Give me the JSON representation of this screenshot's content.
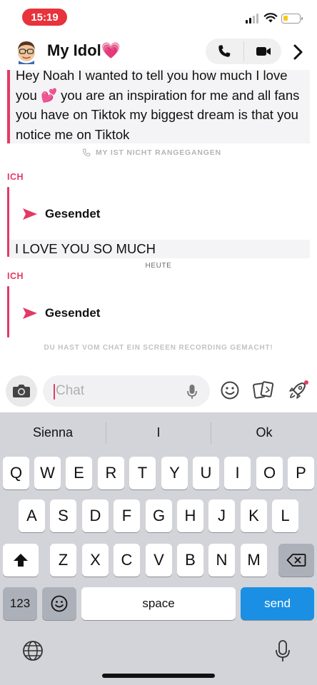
{
  "status_bar": {
    "time": "15:19",
    "battery_color": "#f7c821"
  },
  "header": {
    "contact_name": "My Idol💗"
  },
  "chat": {
    "message_1": "Hey Noah I wanted to tell you how much I love you 💕 you are an inspiration for me and all fans you have on Tiktok my biggest dream is that you notice me on Tiktok",
    "missed_call": "MY IST NICHT RANGEGANGEN",
    "sender_label": "ICH",
    "sent_status": "Gesendet",
    "message_2": "I LOVE YOU SO MUCH",
    "date_divider": "HEUTE",
    "screen_recording_notice": "DU HAST VOM CHAT EIN SCREEN RECORDING GEMACHT!"
  },
  "input": {
    "placeholder": "Chat",
    "value": ""
  },
  "keyboard": {
    "suggestions": [
      "Sienna",
      "I",
      "Ok"
    ],
    "row1": [
      "Q",
      "W",
      "E",
      "R",
      "T",
      "Y",
      "U",
      "I",
      "O",
      "P"
    ],
    "row2": [
      "A",
      "S",
      "D",
      "F",
      "G",
      "H",
      "J",
      "K",
      "L"
    ],
    "row3": [
      "Z",
      "X",
      "C",
      "V",
      "B",
      "N",
      "M"
    ],
    "numbers_key": "123",
    "space_key": "space",
    "send_key": "send"
  },
  "colors": {
    "accent": "#e33a64",
    "send": "#1a8fe3",
    "status_pill": "#e8323c"
  },
  "icons": [
    "phone-icon",
    "video-icon",
    "chevron-right-icon",
    "camera-icon",
    "microphone-icon",
    "emoji-icon",
    "cards-icon",
    "rocket-icon",
    "shift-icon",
    "backspace-icon",
    "globe-icon",
    "send-arrow-icon",
    "missed-call-icon"
  ]
}
